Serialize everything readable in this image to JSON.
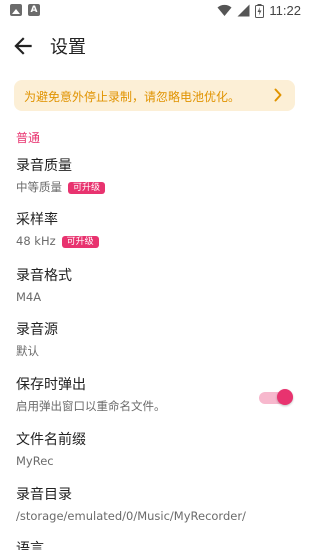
{
  "status_bar": {
    "time": "11:22",
    "icons": [
      "gallery-icon",
      "text-a-icon",
      "wifi-icon",
      "signal-icon",
      "battery-charging-icon"
    ]
  },
  "app_bar": {
    "title": "设置",
    "back_icon": "arrow-back-icon"
  },
  "banner": {
    "text": "为避免意外停止录制，请忽略电池优化。",
    "chevron_icon": "chevron-right-icon",
    "colors": {
      "background": "#fcefd6",
      "text": "#e09300"
    }
  },
  "section": {
    "title": "普通",
    "color": "#e8336f"
  },
  "items": [
    {
      "title": "录音质量",
      "subtitle": "中等质量",
      "badge": "可升级"
    },
    {
      "title": "采样率",
      "subtitle": "48 kHz",
      "badge": "可升级"
    },
    {
      "title": "录音格式",
      "subtitle": "M4A"
    },
    {
      "title": "录音源",
      "subtitle": "默认"
    },
    {
      "title": "保存时弹出",
      "subtitle": "启用弹出窗口以重命名文件。",
      "toggle_on": true
    },
    {
      "title": "文件名前缀",
      "subtitle": "MyRec"
    },
    {
      "title": "录音目录",
      "subtitle": "/storage/emulated/0/Music/MyRecorder/"
    },
    {
      "title": "语言"
    }
  ],
  "accent_color": "#e8336f"
}
